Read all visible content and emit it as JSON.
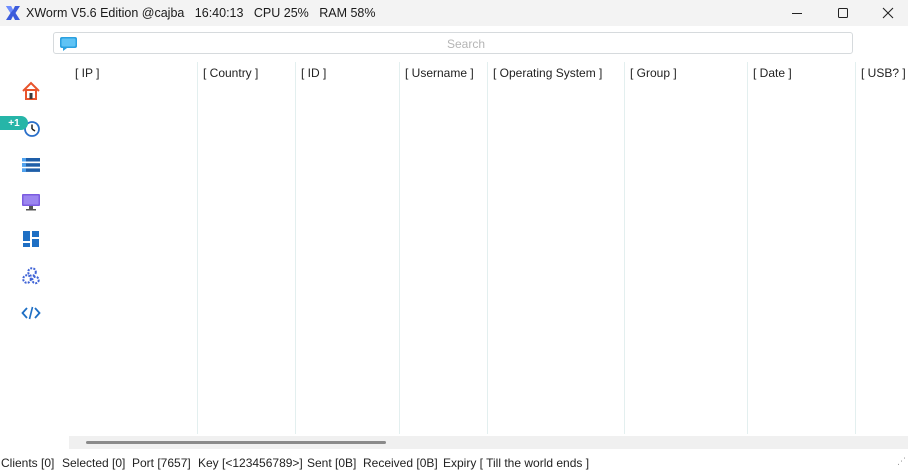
{
  "window": {
    "title": "XWorm V5.6 Edition @cajba",
    "time": "16:40:13",
    "cpu": "CPU 25%",
    "ram": "RAM 58%",
    "icon": "xworm-logo-icon",
    "controls": [
      "minimize-icon",
      "maximize-icon",
      "close-icon"
    ]
  },
  "search": {
    "placeholder": "Search",
    "value": ""
  },
  "sidebar": {
    "items": [
      {
        "name": "home",
        "icon": "home-icon"
      },
      {
        "name": "history",
        "icon": "clock-icon",
        "badge": "+1"
      },
      {
        "name": "list",
        "icon": "list-icon"
      },
      {
        "name": "monitor",
        "icon": "monitor-icon"
      },
      {
        "name": "dashboard",
        "icon": "dashboard-icon"
      },
      {
        "name": "settings",
        "icon": "gears-icon"
      },
      {
        "name": "builder",
        "icon": "code-icon"
      }
    ]
  },
  "table": {
    "columns": [
      "[ IP ]",
      "[ Country ]",
      "[ ID ]",
      "[ Username ]",
      "[ Operating System ]",
      "[ Group ]",
      "[ Date ]",
      "[ USB? ]"
    ],
    "rows": []
  },
  "status": {
    "clients": "Clients [0]",
    "selected": "Selected [0]",
    "port": "Port [7657]",
    "key": "Key [<123456789>]",
    "sent": "Sent [0B]",
    "received": "Received [0B]",
    "expiry": "Expiry [ Till the world ends ]"
  },
  "colors": {
    "accent": "#26b5a8",
    "titlebar": "#f3f3f3",
    "logo": "#3b5bdb"
  }
}
